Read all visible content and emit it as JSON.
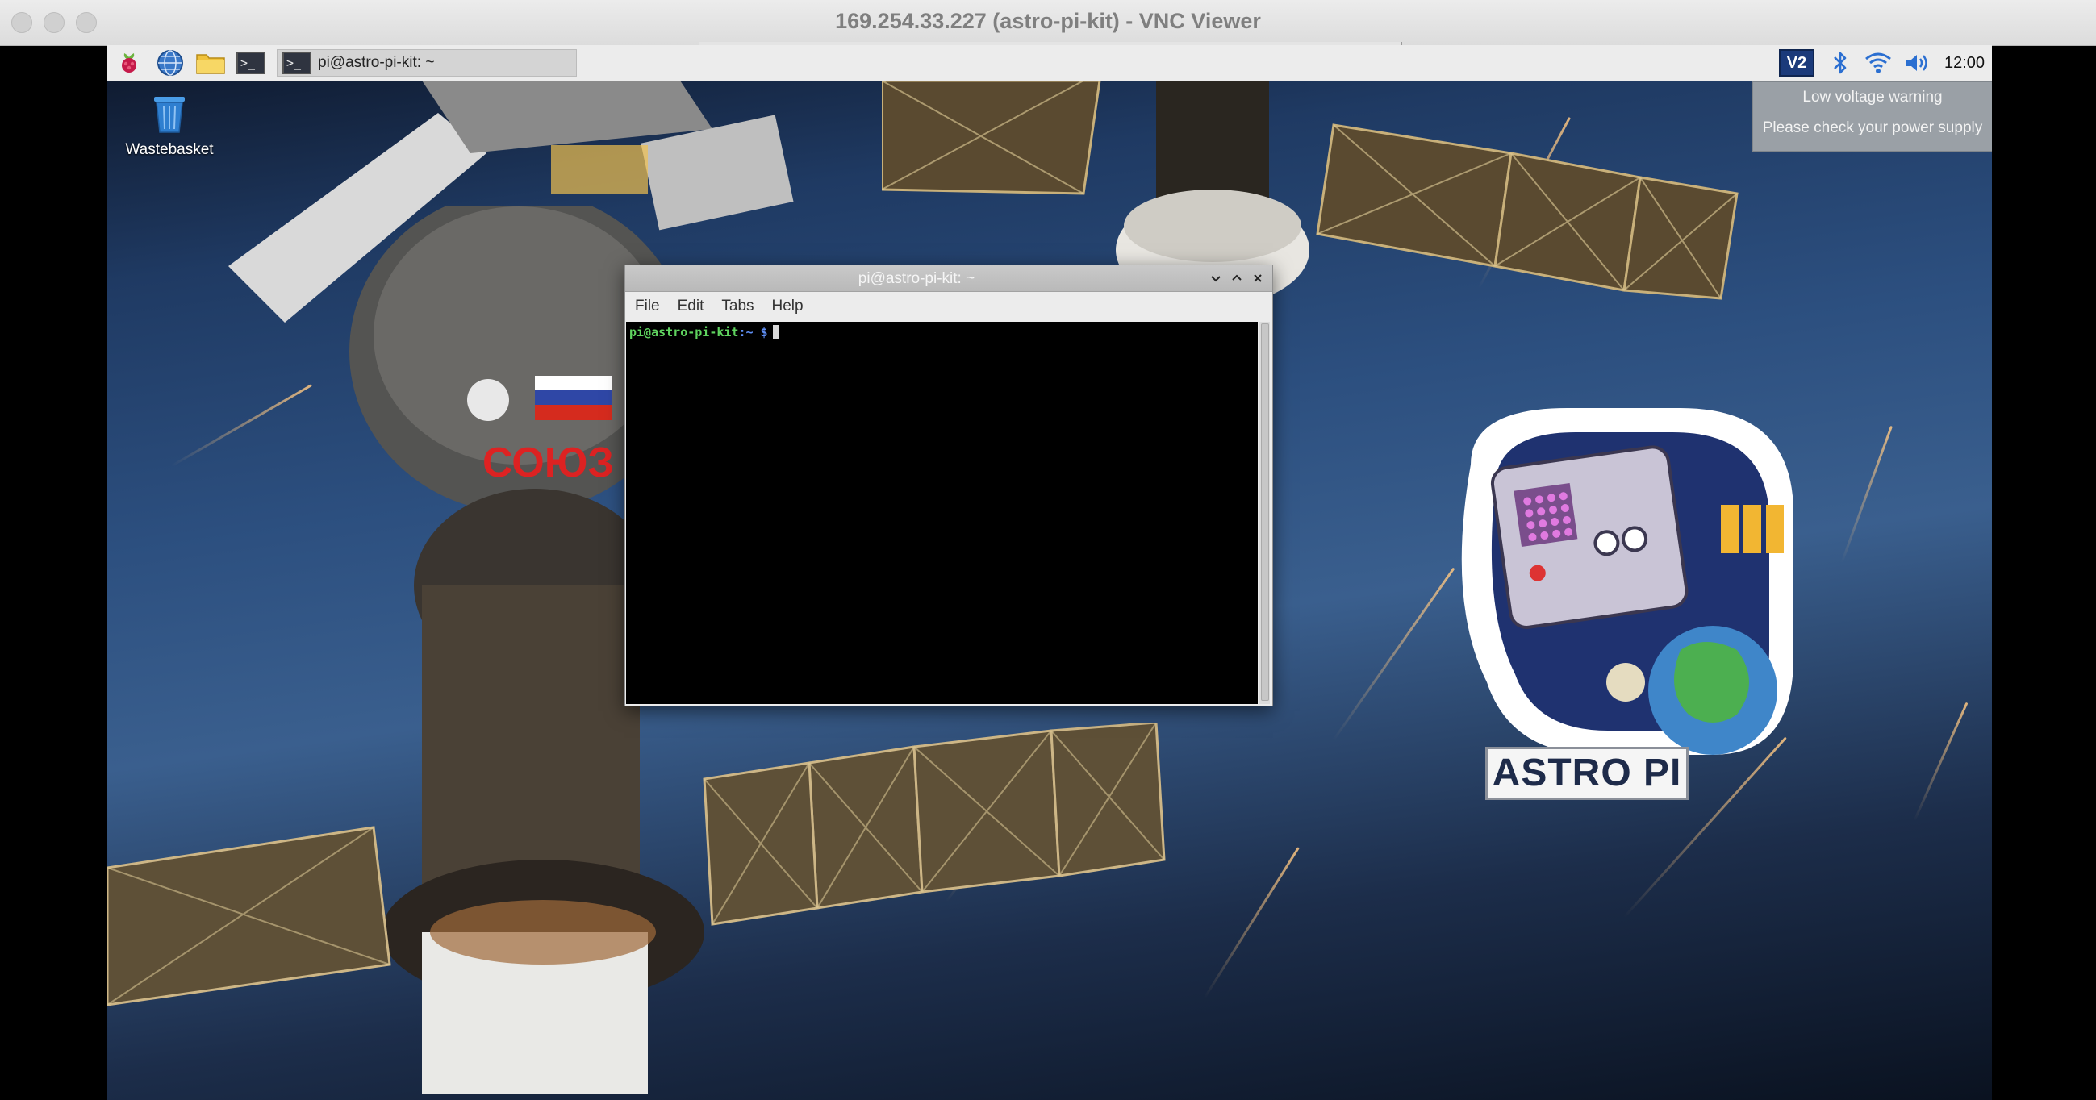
{
  "window": {
    "title": "169.254.33.227 (astro-pi-kit) - VNC Viewer"
  },
  "panel": {
    "launchers": [
      "raspberry-menu-icon",
      "web-browser-icon",
      "file-manager-icon",
      "terminal-icon"
    ],
    "task_button_label": "pi@astro-pi-kit: ~",
    "tray_vnc_label": "V2",
    "clock": "12:00"
  },
  "desktop": {
    "icons": [
      {
        "label": "Wastebasket",
        "icon": "trash-icon"
      }
    ]
  },
  "notification": {
    "line1": "Low voltage warning",
    "line2": "Please check your power supply"
  },
  "terminal": {
    "title": "pi@astro-pi-kit: ~",
    "menu": [
      "File",
      "Edit",
      "Tabs",
      "Help"
    ],
    "prompt_user": "pi@astro-pi-kit",
    "prompt_path": ":~ $",
    "colors": {
      "user": "#5fd35f",
      "path": "#5f8ff5",
      "background": "#000000"
    }
  },
  "wallpaper": {
    "soyuz_text": "СОЮЗ",
    "logo_text": "ASTRO PI"
  }
}
